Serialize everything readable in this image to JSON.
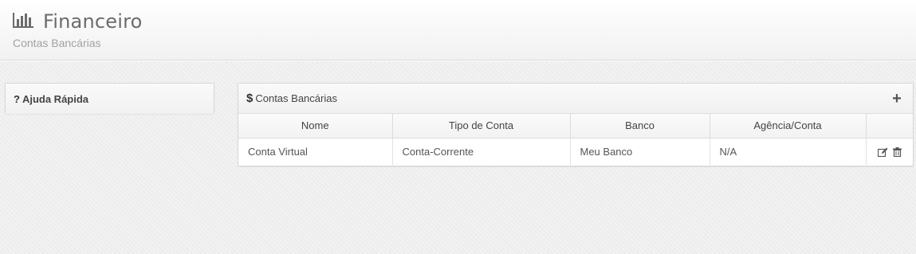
{
  "header": {
    "title": "Financeiro",
    "subtitle": "Contas Bancárias",
    "icon": "bar-chart-icon"
  },
  "help_panel": {
    "icon": "question-icon",
    "icon_glyph": "?",
    "title": "Ajuda Rápida"
  },
  "accounts_panel": {
    "icon": "dollar-icon",
    "icon_glyph": "$",
    "title": "Contas Bancárias",
    "add_icon": "plus-icon",
    "add_glyph": "+",
    "columns": [
      "Nome",
      "Tipo de Conta",
      "Banco",
      "Agência/Conta",
      ""
    ],
    "rows": [
      {
        "nome": "Conta Virtual",
        "tipo": "Conta-Corrente",
        "banco": "Meu Banco",
        "agencia": "N/A",
        "actions": [
          "edit-icon",
          "trash-icon"
        ]
      }
    ]
  }
}
